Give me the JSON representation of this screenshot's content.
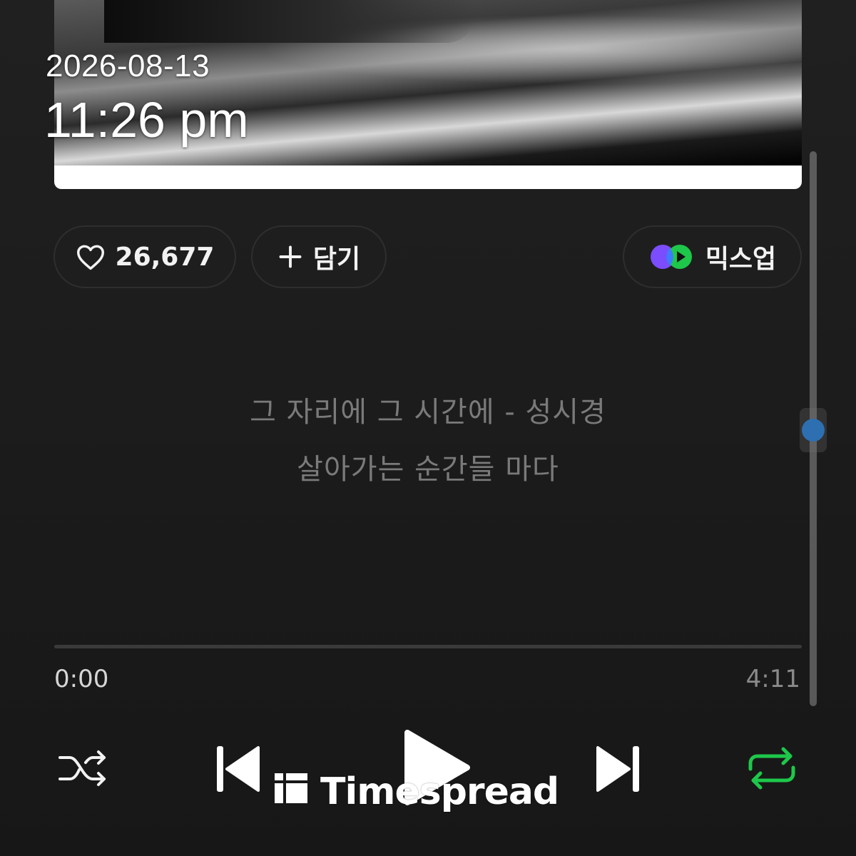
{
  "overlay": {
    "date": "2026-08-13",
    "time": "11:26 pm"
  },
  "actions": {
    "like_icon": "heart-outline-icon",
    "like_count": "26,677",
    "add_icon": "plus-icon",
    "add_label": "담기",
    "mixup_icon": "mixup-logo-icon",
    "mixup_label": "믹스업"
  },
  "lyrics": {
    "line1": "그 자리에 그 시간에 - 성시경",
    "line2": "살아가는 순간들 마다"
  },
  "playback": {
    "current_time": "0:00",
    "total_time": "4:11",
    "progress_fraction": 0.0
  },
  "controls": {
    "shuffle_icon": "shuffle-icon",
    "prev_icon": "skip-previous-icon",
    "play_icon": "play-icon",
    "next_icon": "skip-next-icon",
    "repeat_icon": "repeat-icon",
    "repeat_active_color": "#1ec74a"
  },
  "watermark": {
    "logo_icon": "timespread-logo-icon",
    "text": "Timespread"
  },
  "colors": {
    "background": "#1c1c1c",
    "lyrics_text": "#7a7a7a",
    "scroll_thumb": "#2d6fb0",
    "mixup_purple": "#7b4dff",
    "mixup_blue": "#3d7bff",
    "mixup_green": "#1ec74a"
  }
}
